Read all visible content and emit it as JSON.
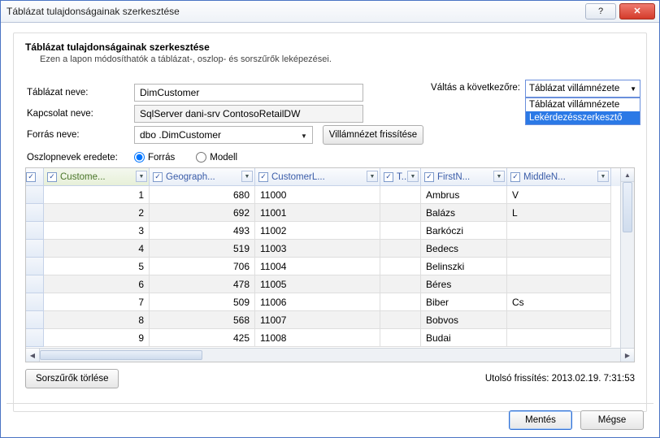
{
  "window": {
    "title": "Táblázat tulajdonságainak szerkesztése"
  },
  "header": {
    "caption": "Táblázat tulajdonságainak szerkesztése",
    "sub": "Ezen a lapon módosíthatók a táblázat-, oszlop- és sorszűrők leképezései."
  },
  "form": {
    "tableNameLabel": "Táblázat neve:",
    "tableName": "DimCustomer",
    "connNameLabel": "Kapcsolat neve:",
    "connName": "SqlServer dani-srv ContosoRetailDW",
    "sourceNameLabel": "Forrás neve:",
    "sourceName": "dbo .DimCustomer",
    "refreshBtn": "Villámnézet frissítése",
    "colNamesLabel": "Oszlopnevek eredete:",
    "radioSource": "Forrás",
    "radioModel": "Modell"
  },
  "switch": {
    "label": "Váltás a következőre:",
    "valueTable": "Táblázat villámnézete",
    "valueQuery": "Lekérdezésszerkesztő"
  },
  "grid": {
    "cols": [
      {
        "label": "Custome..."
      },
      {
        "label": "Geograph..."
      },
      {
        "label": "CustomerL..."
      },
      {
        "label": "T..."
      },
      {
        "label": "FirstN..."
      },
      {
        "label": "MiddleN..."
      }
    ],
    "rows": [
      {
        "c1": "1",
        "c2": "680",
        "c3": "11000",
        "c4": "",
        "c5": "Ambrus",
        "c6": "V"
      },
      {
        "c1": "2",
        "c2": "692",
        "c3": "11001",
        "c4": "",
        "c5": "Balázs",
        "c6": "L"
      },
      {
        "c1": "3",
        "c2": "493",
        "c3": "11002",
        "c4": "",
        "c5": "Barkóczi",
        "c6": ""
      },
      {
        "c1": "4",
        "c2": "519",
        "c3": "11003",
        "c4": "",
        "c5": "Bedecs",
        "c6": ""
      },
      {
        "c1": "5",
        "c2": "706",
        "c3": "11004",
        "c4": "",
        "c5": "Belinszki",
        "c6": ""
      },
      {
        "c1": "6",
        "c2": "478",
        "c3": "11005",
        "c4": "",
        "c5": "Béres",
        "c6": ""
      },
      {
        "c1": "7",
        "c2": "509",
        "c3": "11006",
        "c4": "",
        "c5": "Biber",
        "c6": "Cs"
      },
      {
        "c1": "8",
        "c2": "568",
        "c3": "11007",
        "c4": "",
        "c5": "Bobvos",
        "c6": ""
      },
      {
        "c1": "9",
        "c2": "425",
        "c3": "11008",
        "c4": "",
        "c5": "Budai",
        "c6": ""
      }
    ]
  },
  "footer": {
    "clearFilters": "Sorszűrők törlése",
    "lastUpdate": "Utolsó frissítés: 2013.02.19. 7:31:53",
    "save": "Mentés",
    "cancel": "Mégse",
    "help": "?",
    "close": "✕"
  }
}
